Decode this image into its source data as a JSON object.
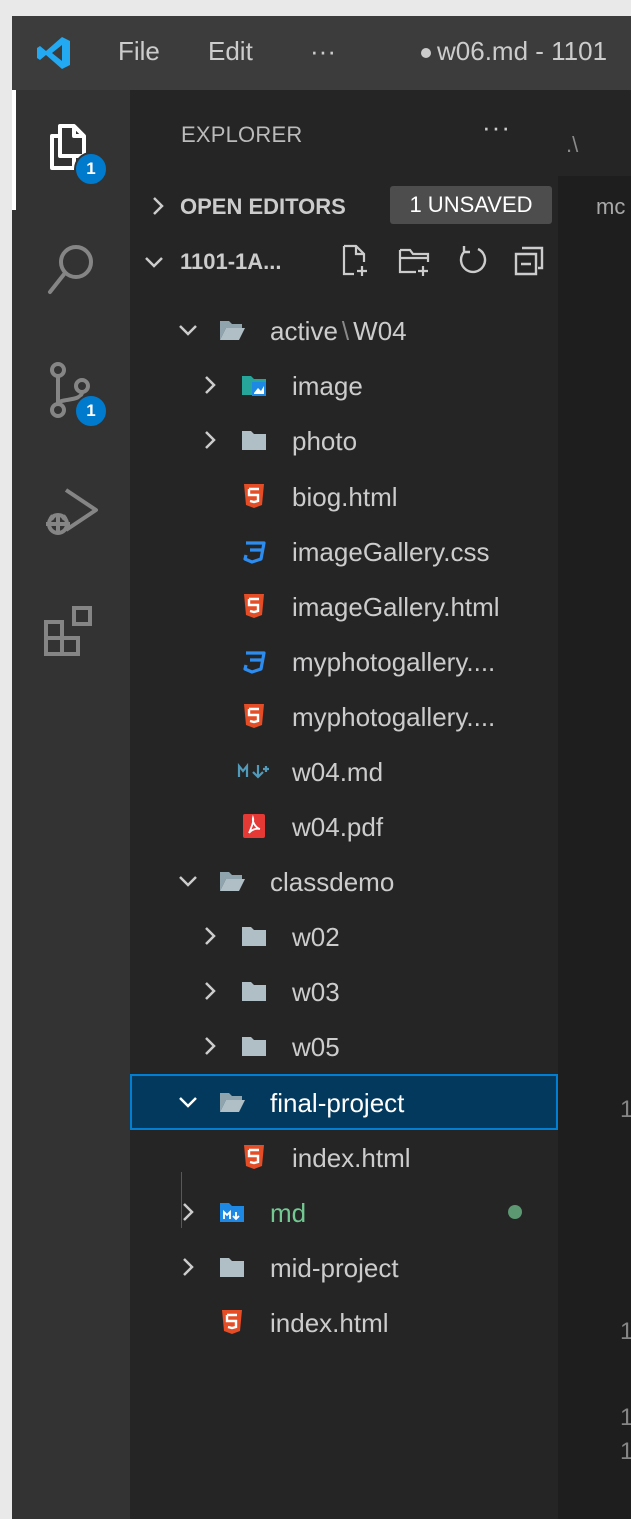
{
  "titlebar": {
    "menu": [
      "File",
      "Edit",
      "···"
    ],
    "title": "w06.md - 1101"
  },
  "activity_bar": {
    "items": [
      {
        "icon": "explorer-icon",
        "badge": "1"
      },
      {
        "icon": "search-icon"
      },
      {
        "icon": "source-control-icon",
        "badge": "1"
      },
      {
        "icon": "run-debug-icon"
      },
      {
        "icon": "extensions-icon"
      }
    ]
  },
  "sidebar": {
    "title": "EXPLORER",
    "more": "···",
    "open_editors": {
      "label": "OPEN EDITORS",
      "badge": "1 UNSAVED"
    },
    "workspace": {
      "label": "1101-1A..."
    },
    "tree": [
      {
        "label": "active",
        "label2": "W04",
        "type": "folder-open"
      },
      {
        "label": "image",
        "type": "folder-image"
      },
      {
        "label": "photo",
        "type": "folder"
      },
      {
        "label": "biog.html",
        "type": "html"
      },
      {
        "label": "imageGallery.css",
        "type": "css"
      },
      {
        "label": "imageGallery.html",
        "type": "html"
      },
      {
        "label": "myphotogallery....",
        "type": "css"
      },
      {
        "label": "myphotogallery....",
        "type": "html"
      },
      {
        "label": "w04.md",
        "type": "markdown"
      },
      {
        "label": "w04.pdf",
        "type": "pdf"
      },
      {
        "label": "classdemo",
        "type": "folder-open"
      },
      {
        "label": "w02",
        "type": "folder"
      },
      {
        "label": "w03",
        "type": "folder"
      },
      {
        "label": "w05",
        "type": "folder"
      },
      {
        "label": "final-project",
        "type": "folder-open"
      },
      {
        "label": "index.html",
        "type": "html"
      },
      {
        "label": "md",
        "type": "folder-md"
      },
      {
        "label": "mid-project",
        "type": "folder"
      },
      {
        "label": "index.html",
        "type": "html"
      }
    ]
  },
  "editor": {
    "tab_fragment": ".\\",
    "breadcrumb_fragment": "mc",
    "line_fragments": [
      "1",
      "1",
      "1",
      "1"
    ]
  },
  "colors": {
    "accent": "#007acc",
    "selection": "#04395e",
    "html": "#e44d26",
    "css": "#2d8cf0",
    "git_untracked": "#73c991"
  }
}
